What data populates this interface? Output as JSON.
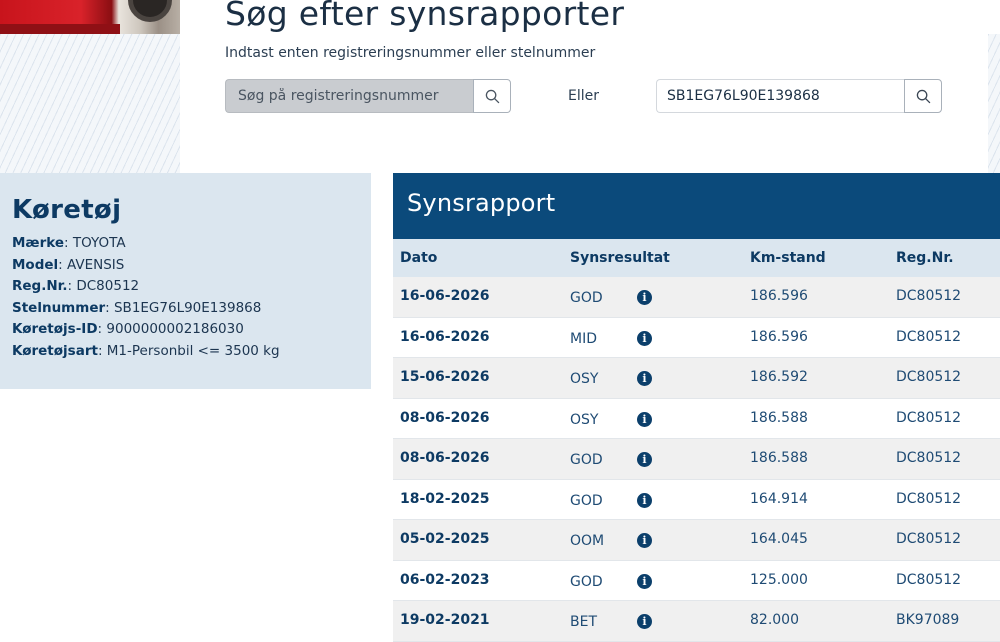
{
  "search": {
    "title": "Søg efter synsrapporter",
    "subtitle": "Indtast enten registreringsnummer eller stelnummer",
    "reg_placeholder": "Søg på registreringsnummer",
    "reg_value": "",
    "or_label": "Eller",
    "vin_value": "SB1EG76L90E139868"
  },
  "vehicle": {
    "title": "Køretøj",
    "fields": [
      {
        "label": "Mærke",
        "value": "TOYOTA"
      },
      {
        "label": "Model",
        "value": "AVENSIS"
      },
      {
        "label": "Reg.Nr.",
        "value": "DC80512"
      },
      {
        "label": "Stelnummer",
        "value": "SB1EG76L90E139868"
      },
      {
        "label": "Køretøjs-ID",
        "value": "9000000002186030"
      },
      {
        "label": "Køretøjsart",
        "value": "M1-Personbil <= 3500 kg"
      }
    ]
  },
  "report": {
    "title": "Synsrapport",
    "columns": {
      "date": "Dato",
      "result": "Synsresultat",
      "km": "Km-stand",
      "reg": "Reg.Nr."
    },
    "rows": [
      {
        "date": "16-06-2026",
        "result": "GOD",
        "km": "186.596",
        "reg": "DC80512"
      },
      {
        "date": "16-06-2026",
        "result": "MID",
        "km": "186.596",
        "reg": "DC80512"
      },
      {
        "date": "15-06-2026",
        "result": "OSY",
        "km": "186.592",
        "reg": "DC80512"
      },
      {
        "date": "08-06-2026",
        "result": "OSY",
        "km": "186.588",
        "reg": "DC80512"
      },
      {
        "date": "08-06-2026",
        "result": "GOD",
        "km": "186.588",
        "reg": "DC80512"
      },
      {
        "date": "18-02-2025",
        "result": "GOD",
        "km": "164.914",
        "reg": "DC80512"
      },
      {
        "date": "05-02-2025",
        "result": "OOM",
        "km": "164.045",
        "reg": "DC80512"
      },
      {
        "date": "06-02-2023",
        "result": "GOD",
        "km": "125.000",
        "reg": "DC80512"
      },
      {
        "date": "19-02-2021",
        "result": "BET",
        "km": "82.000",
        "reg": "BK97089"
      }
    ],
    "info_glyph": "i"
  },
  "colors": {
    "header_blue": "#0b4a7b",
    "panel_blue": "#dbe6ef",
    "title_blue": "#0d3a63"
  },
  "icons": {
    "search": "search-icon",
    "info": "info-icon"
  }
}
